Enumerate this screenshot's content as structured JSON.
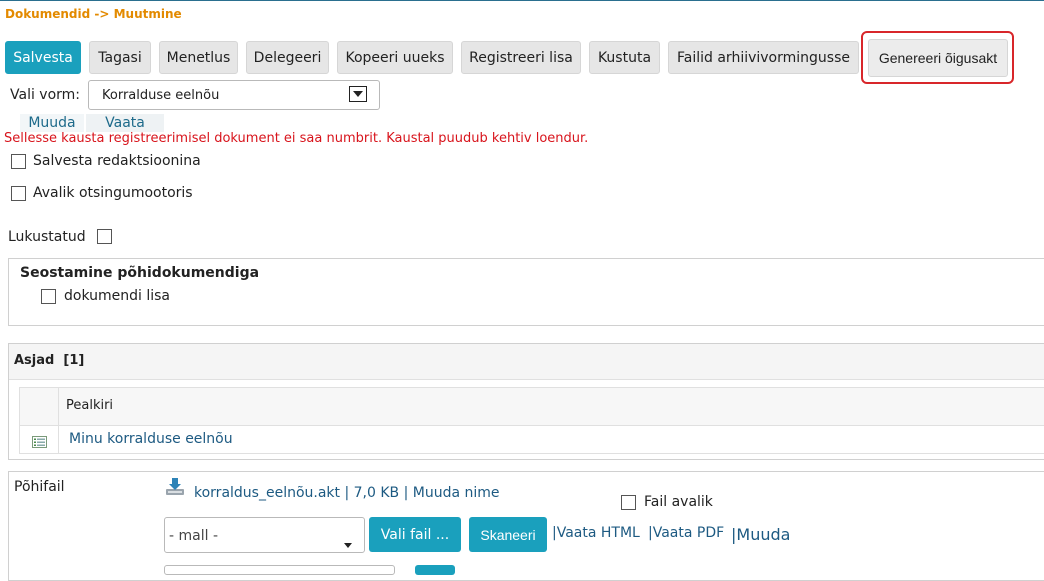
{
  "breadcrumb": "Dokumendid -> Muutmine",
  "toolbar": {
    "buttons": [
      "Salvesta",
      "Tagasi",
      "Menetlus",
      "Delegeeri",
      "Kopeeri uueks",
      "Registreeri lisa",
      "Kustuta",
      "Failid arhiivivormingusse"
    ],
    "generate": "Genereeri õigusakt"
  },
  "form": {
    "vali_vorm_label": "Vali vorm:",
    "vali_vorm_value": "Korralduse eelnõu",
    "tabs": [
      "Muuda",
      "Vaata"
    ],
    "error": "Sellesse kausta registreerimisel dokument ei saa numbrit. Kaustal puudub kehtiv loendur.",
    "salvesta_redaktsioonina": "Salvesta redaktsioonina",
    "avalik_otsingumootoris": "Avalik otsingumootoris",
    "lukustatud": "Lukustatud"
  },
  "seostamine": {
    "title": "Seostamine põhidokumendiga",
    "option": "dokumendi lisa"
  },
  "asjad": {
    "title": "Asjad",
    "count": "[1]",
    "column": "Pealkiri",
    "rows": [
      "Minu korralduse eelnõu"
    ]
  },
  "pohifail": {
    "label": "Põhifail",
    "file_name": "korraldus_eelnõu.akt",
    "file_size": "| 7,0 KB |",
    "rename": "Muuda nime",
    "fail_avalik": "Fail avalik",
    "mall_value": "- mall -",
    "vali_fail": "Vali fail ...",
    "skaneeri": "Skaneeri",
    "vaata_html": "|Vaata HTML",
    "vaata_pdf": "|Vaata PDF",
    "muuda": "|Muuda"
  },
  "colors": {
    "accent": "#1aa0bd",
    "breadcrumb": "#e38a00",
    "error": "#d8141c",
    "highlight": "#d8262a"
  }
}
